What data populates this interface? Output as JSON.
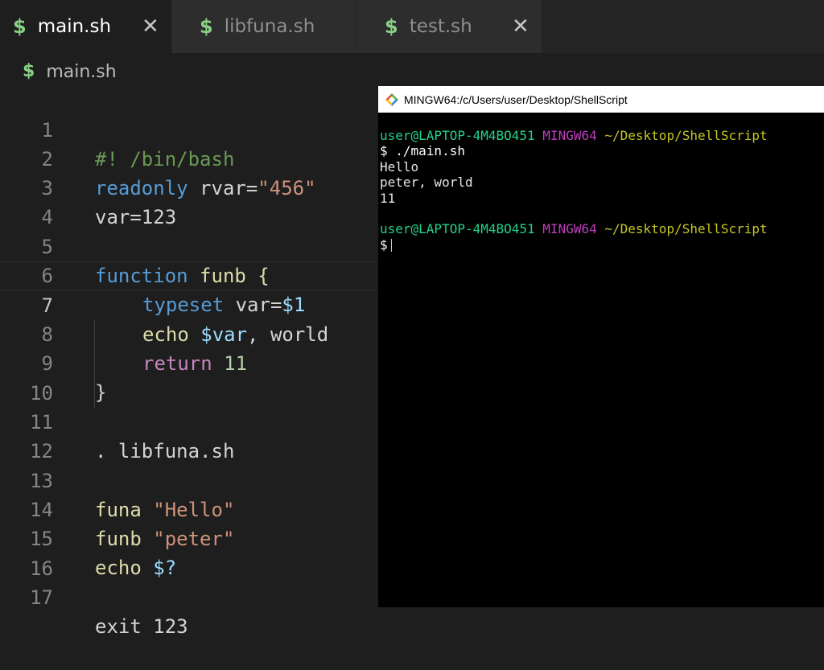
{
  "tabs": [
    {
      "icon": "$",
      "label": "main.sh",
      "active": true,
      "close": "✕"
    },
    {
      "icon": "$",
      "label": "libfuna.sh",
      "active": false
    },
    {
      "icon": "$",
      "label": "test.sh",
      "active": false,
      "close": "✕"
    }
  ],
  "breadcrumb": {
    "icon": "$",
    "label": "main.sh"
  },
  "editor": {
    "line_numbers": [
      "1",
      "2",
      "3",
      "4",
      "5",
      "6",
      "7",
      "8",
      "9",
      "10",
      "11",
      "12",
      "13",
      "14",
      "15",
      "16",
      "17"
    ],
    "current_line": 7,
    "code": {
      "l1": {
        "comment": "#! /bin/bash"
      },
      "l2": {
        "kw": "readonly",
        "rest": " rvar=",
        "str": "\"456\""
      },
      "l3": {
        "text": "var=123"
      },
      "l5": {
        "kw": "function",
        "rest": " funb {"
      },
      "l6": {
        "kw": "typeset",
        "rest": " var=",
        "var": "$1"
      },
      "l7": {
        "func": "echo",
        "var": " $var",
        "rest": ", world"
      },
      "l8": {
        "ctrl": "return",
        "num": " 11"
      },
      "l9": {
        "text": "}"
      },
      "l11": {
        "text": ". libfuna.sh"
      },
      "l13": {
        "func": "funa",
        "str": " \"Hello\""
      },
      "l14": {
        "func": "funb",
        "str": " \"peter\""
      },
      "l15": {
        "func": "echo",
        "var": " $?"
      },
      "l17": {
        "text": "exit 123"
      }
    }
  },
  "terminal": {
    "title": "MINGW64:/c/Users/user/Desktop/ShellScript",
    "prompt_user": "user@LAPTOP-4M4BO451",
    "prompt_host": "MINGW64",
    "prompt_path": "~/Desktop/ShellScript",
    "command": "$ ./main.sh",
    "output": [
      "Hello",
      "peter, world",
      "11"
    ],
    "prompt_symbol": "$"
  },
  "colors": {
    "editor_bg": "#1e1e1e",
    "tab_inactive_bg": "#2d2d2d",
    "shell_icon": "#89d185",
    "terminal_bg": "#000000",
    "prompt_user": "#23d18b",
    "prompt_host": "#bc3fbc",
    "prompt_path": "#c5c525"
  }
}
